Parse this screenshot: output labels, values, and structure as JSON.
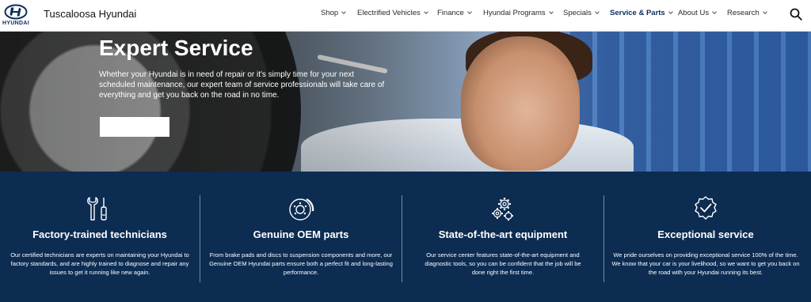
{
  "header": {
    "logo_text": "HYUNDAI",
    "dealer_name": "Tuscaloosa Hyundai",
    "nav": [
      {
        "label": "Shop",
        "active": false
      },
      {
        "label": "Electrified Vehicles",
        "active": false
      },
      {
        "label": "Finance",
        "active": false
      },
      {
        "label": "Hyundai Programs",
        "active": false
      },
      {
        "label": "Specials",
        "active": false
      },
      {
        "label": "Service & Parts",
        "active": true
      },
      {
        "label": "About Us",
        "active": false
      },
      {
        "label": "Research",
        "active": false
      }
    ],
    "search_icon": "search-icon"
  },
  "hero": {
    "title": "Expert Service",
    "text": "Whether your Hyundai is in need of repair or it's simply time for your next scheduled maintenance, our expert team of service professionals will take care of everything and get you back on the road in no time.",
    "button_label": ""
  },
  "features": [
    {
      "icon": "tools-icon",
      "title": "Factory-trained technicians",
      "text": "Our certified technicians are experts on maintaining your Hyundai to factory standards, and are highly trained to diagnose and repair any issues to get it running like new again."
    },
    {
      "icon": "brake-disc-icon",
      "title": "Genuine OEM parts",
      "text": "From brake pads and discs to suspension components and more, our Genuine OEM Hyundai parts ensure both a perfect fit and long-lasting performance."
    },
    {
      "icon": "gears-icon",
      "title": "State-of-the-art equipment",
      "text": "Our service center features state-of-the-art equipment and diagnostic tools, so you can be confident that the job will be done right the first time."
    },
    {
      "icon": "checkmark-badge-icon",
      "title": "Exceptional service",
      "text": "We pride ourselves on providing exceptional service 100% of the time. We know that your car is your livelihood, so we want to get you back on the road with your Hyundai running its best."
    }
  ],
  "colors": {
    "brand_navy": "#0c2c52",
    "nav_active": "#0c2c5c"
  }
}
